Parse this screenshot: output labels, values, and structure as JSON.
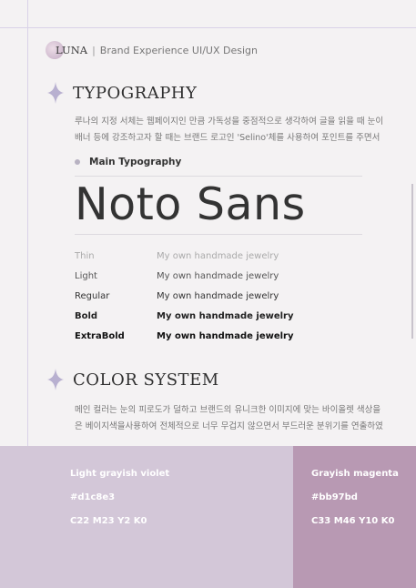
{
  "brand": {
    "name": "LUNA",
    "separator": "|",
    "tagline": "Brand Experience UI/UX Design"
  },
  "typography": {
    "title": "TYPOGRAPHY",
    "paragraph": [
      "루나의 지정 서체는 웹페이지인 만큼 가독성을 중점적으로 생각하여 글을 읽을 때 눈이",
      "배너 등에 강조하고자 할 때는 브랜드 로고인 'Selino'체를 사용하여 포인트를 주면서"
    ],
    "subheading": "Main Typography",
    "font_name": "Noto Sans",
    "weights": [
      {
        "name": "Thin",
        "sample": "My own handmade jewelry"
      },
      {
        "name": "Light",
        "sample": "My own handmade jewelry"
      },
      {
        "name": "Regular",
        "sample": "My own handmade jewelry"
      },
      {
        "name": "Bold",
        "sample": "My own handmade jewelry"
      },
      {
        "name": "ExtraBold",
        "sample": "My own handmade jewelry"
      }
    ]
  },
  "color_system": {
    "title": "COLOR SYSTEM",
    "paragraph": [
      "메인 컬러는 눈의 피로도가 덜하고 브랜드의 유니크한 이미지에 맞는 바이올렛 색상을",
      "은 베이지색을사용하여 전체적으로 너무 무겁지 않으면서 부드러운 분위기를 연출하였"
    ],
    "swatches": [
      {
        "name": "Light grayish violet",
        "hex": "#d1c8e3",
        "cmyk": "C22 M23 Y2 K0",
        "display_color": "#d3c7d8"
      },
      {
        "name": "Grayish magenta",
        "hex": "#bb97bd",
        "cmyk": "C33 M46 Y10 K0",
        "display_color": "#b899b3"
      }
    ]
  },
  "colors": {
    "background": "#f4f2f3",
    "guide_line": "#d9d2e8",
    "sparkle": "#b8b0d0"
  }
}
